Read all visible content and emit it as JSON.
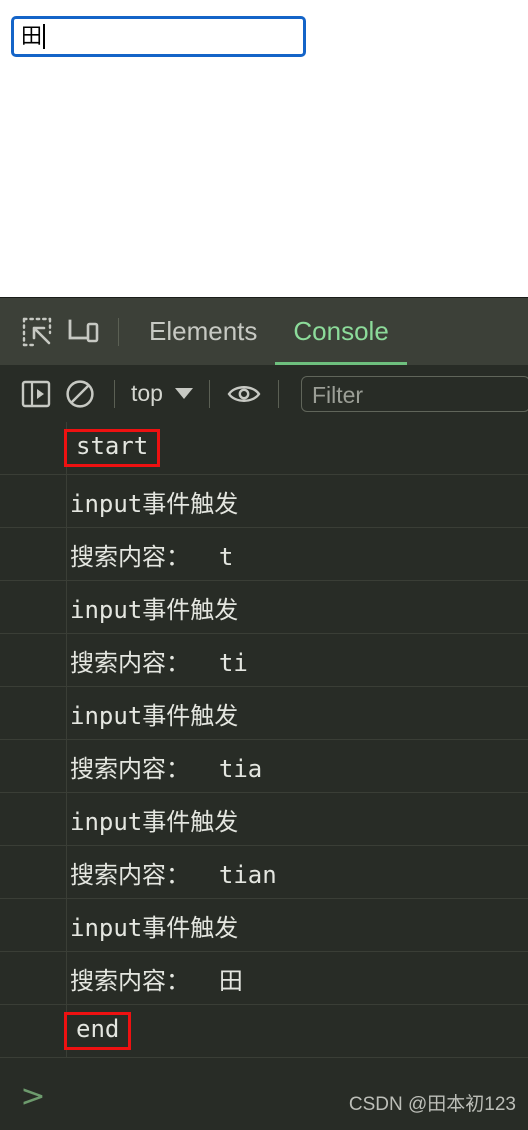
{
  "page": {
    "search_input": {
      "value": "田",
      "placeholder": ""
    }
  },
  "devtools": {
    "tabs": [
      {
        "label": "Elements",
        "active": false
      },
      {
        "label": "Console",
        "active": true
      }
    ],
    "icons": {
      "inspect": "inspect-element-icon",
      "device": "device-toolbar-icon",
      "sidebar": "console-sidebar-toggle-icon",
      "clear": "clear-console-icon",
      "eye": "live-expression-eye-icon"
    },
    "console_toolbar": {
      "context": "top",
      "filter_placeholder": "Filter"
    },
    "messages": [
      {
        "text": "start",
        "highlight": true
      },
      {
        "text": "input事件触发",
        "highlight": false
      },
      {
        "text": "搜索内容：  t",
        "highlight": false
      },
      {
        "text": "input事件触发",
        "highlight": false
      },
      {
        "text": "搜索内容：  ti",
        "highlight": false
      },
      {
        "text": "input事件触发",
        "highlight": false
      },
      {
        "text": "搜索内容：  tia",
        "highlight": false
      },
      {
        "text": "input事件触发",
        "highlight": false
      },
      {
        "text": "搜索内容：  tian",
        "highlight": false
      },
      {
        "text": "input事件触发",
        "highlight": false
      },
      {
        "text": "搜索内容：  田",
        "highlight": false
      },
      {
        "text": "end",
        "highlight": true
      }
    ],
    "prompt": ">",
    "watermark": "CSDN @田本初123"
  },
  "colors": {
    "accent_border": "#1464c8",
    "panel_bg": "#282c26",
    "toolbar_bg": "#3c4038",
    "active_tab": "#8cdb9a",
    "highlight_box": "#ee1111",
    "prompt_green": "#6d9b6d"
  }
}
